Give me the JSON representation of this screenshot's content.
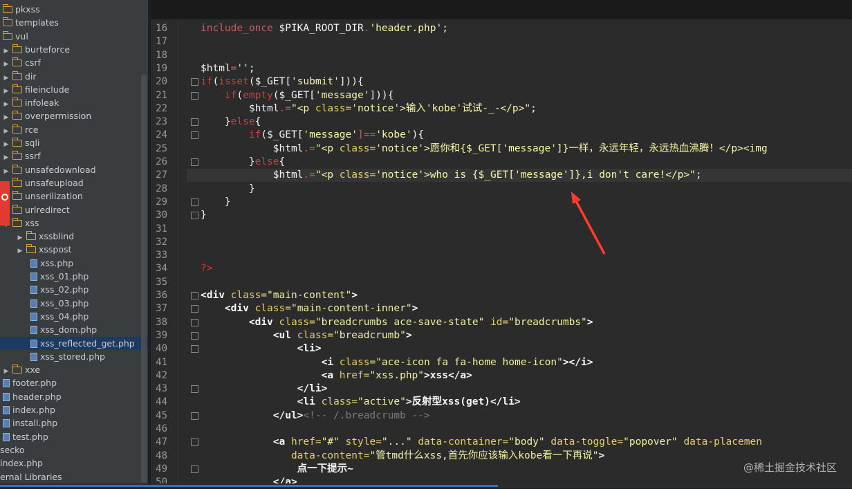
{
  "sidebar": {
    "items": [
      {
        "label": "pkxss",
        "type": "folder",
        "indent": 0,
        "arrow": false
      },
      {
        "label": "templates",
        "type": "folder",
        "indent": 0,
        "arrow": false
      },
      {
        "label": "vul",
        "type": "folder",
        "indent": 0,
        "arrow": false
      },
      {
        "label": "burteforce",
        "type": "folder",
        "indent": 1,
        "arrow": true
      },
      {
        "label": "csrf",
        "type": "folder",
        "indent": 1,
        "arrow": true
      },
      {
        "label": "dir",
        "type": "folder",
        "indent": 1,
        "arrow": true
      },
      {
        "label": "fileinclude",
        "type": "folder",
        "indent": 1,
        "arrow": true
      },
      {
        "label": "infoleak",
        "type": "folder",
        "indent": 1,
        "arrow": true
      },
      {
        "label": "overpermission",
        "type": "folder",
        "indent": 1,
        "arrow": true
      },
      {
        "label": "rce",
        "type": "folder",
        "indent": 1,
        "arrow": true
      },
      {
        "label": "sqli",
        "type": "folder",
        "indent": 1,
        "arrow": true
      },
      {
        "label": "ssrf",
        "type": "folder",
        "indent": 1,
        "arrow": true
      },
      {
        "label": "unsafedownload",
        "type": "folder",
        "indent": 1,
        "arrow": true
      },
      {
        "label": "unsafeupload",
        "type": "folder",
        "indent": 1,
        "arrow": true
      },
      {
        "label": "unserilization",
        "type": "folder",
        "indent": 1,
        "arrow": true
      },
      {
        "label": "urlredirect",
        "type": "folder",
        "indent": 1,
        "arrow": true
      },
      {
        "label": "xss",
        "type": "folder",
        "indent": 1,
        "arrow": false
      },
      {
        "label": "xssblind",
        "type": "folder",
        "indent": 2,
        "arrow": true
      },
      {
        "label": "xsspost",
        "type": "folder",
        "indent": 2,
        "arrow": true
      },
      {
        "label": "xss.php",
        "type": "file",
        "indent": 3,
        "arrow": false
      },
      {
        "label": "xss_01.php",
        "type": "file",
        "indent": 3,
        "arrow": false
      },
      {
        "label": "xss_02.php",
        "type": "file",
        "indent": 3,
        "arrow": false
      },
      {
        "label": "xss_03.php",
        "type": "file",
        "indent": 3,
        "arrow": false
      },
      {
        "label": "xss_04.php",
        "type": "file",
        "indent": 3,
        "arrow": false
      },
      {
        "label": "xss_dom.php",
        "type": "file",
        "indent": 3,
        "arrow": false
      },
      {
        "label": "xss_reflected_get.php",
        "type": "file",
        "indent": 3,
        "arrow": false,
        "selected": true
      },
      {
        "label": "xss_stored.php",
        "type": "file",
        "indent": 3,
        "arrow": false
      },
      {
        "label": "xxe",
        "type": "folder",
        "indent": 1,
        "arrow": true
      },
      {
        "label": "footer.php",
        "type": "file",
        "indent": 0,
        "arrow": false
      },
      {
        "label": "header.php",
        "type": "file",
        "indent": 0,
        "arrow": false
      },
      {
        "label": "index.php",
        "type": "file",
        "indent": 0,
        "arrow": false
      },
      {
        "label": "install.php",
        "type": "file",
        "indent": 0,
        "arrow": false
      },
      {
        "label": "test.php",
        "type": "file",
        "indent": 0,
        "arrow": false
      },
      {
        "label": "secko",
        "type": "plain",
        "indent": 0,
        "arrow": false
      },
      {
        "label": "index.php",
        "type": "plain",
        "indent": 0,
        "arrow": false
      },
      {
        "label": "ernal Libraries",
        "type": "plain",
        "indent": 0,
        "arrow": false
      }
    ]
  },
  "editor": {
    "line_numbers": [
      "16",
      "17",
      "18",
      "19",
      "20",
      "21",
      "22",
      "23",
      "24",
      "25",
      "26",
      "27",
      "28",
      "29",
      "30",
      "31",
      "32",
      "33",
      "34",
      "35",
      "36",
      "37",
      "38",
      "39",
      "40",
      "41",
      "42",
      "43",
      "44",
      "45",
      "46",
      "47",
      "48",
      "49",
      "50"
    ],
    "lines": [
      [
        {
          "t": "include_once",
          "c": "dim"
        },
        {
          "t": " $PIKA_ROOT_DIR",
          "c": "v"
        },
        {
          "t": ".",
          "c": "dim"
        },
        {
          "t": "'header.php'",
          "c": "str"
        },
        {
          "t": ";",
          "c": "v"
        }
      ],
      [],
      [],
      [
        {
          "t": "$html",
          "c": "v"
        },
        {
          "t": "=",
          "c": "dim"
        },
        {
          "t": "''",
          "c": "str"
        },
        {
          "t": ";",
          "c": "v"
        }
      ],
      [
        {
          "t": "if",
          "c": "k"
        },
        {
          "t": "(",
          "c": "v"
        },
        {
          "t": "isset",
          "c": "k"
        },
        {
          "t": "($_GET[",
          "c": "v"
        },
        {
          "t": "'submit'",
          "c": "str"
        },
        {
          "t": "])){",
          "c": "v"
        }
      ],
      [
        {
          "t": "    if",
          "c": "k"
        },
        {
          "t": "(",
          "c": "v"
        },
        {
          "t": "empty",
          "c": "k"
        },
        {
          "t": "($_GET[",
          "c": "v"
        },
        {
          "t": "'message'",
          "c": "str"
        },
        {
          "t": "])){",
          "c": "v"
        }
      ],
      [
        {
          "t": "        $html",
          "c": "v"
        },
        {
          "t": ".=",
          "c": "dim"
        },
        {
          "t": "\"<p ",
          "c": "str"
        },
        {
          "t": "class=",
          "c": "a"
        },
        {
          "t": "'notice'",
          "c": "str"
        },
        {
          "t": ">输入'kobe'试试-_-</p>\"",
          "c": "str"
        },
        {
          "t": ";",
          "c": "v"
        }
      ],
      [
        {
          "t": "    }",
          "c": "v"
        },
        {
          "t": "else",
          "c": "k"
        },
        {
          "t": "{",
          "c": "v"
        }
      ],
      [
        {
          "t": "        if",
          "c": "k"
        },
        {
          "t": "($_GET[",
          "c": "v"
        },
        {
          "t": "'message'",
          "c": "str"
        },
        {
          "t": "]==",
          "c": "dim"
        },
        {
          "t": "'kobe'",
          "c": "str"
        },
        {
          "t": "){",
          "c": "v"
        }
      ],
      [
        {
          "t": "            $html",
          "c": "v"
        },
        {
          "t": ".=",
          "c": "dim"
        },
        {
          "t": "\"<p ",
          "c": "str"
        },
        {
          "t": "class=",
          "c": "a"
        },
        {
          "t": "'notice'",
          "c": "str"
        },
        {
          "t": ">愿你和{$_GET['message']}一样，永远年轻，永远热血沸腾！</p><img",
          "c": "str"
        }
      ],
      [
        {
          "t": "        }",
          "c": "v"
        },
        {
          "t": "else",
          "c": "k"
        },
        {
          "t": "{",
          "c": "v"
        }
      ],
      [
        {
          "t": "            $html",
          "c": "v"
        },
        {
          "t": ".=",
          "c": "dim"
        },
        {
          "t": "\"<p ",
          "c": "str"
        },
        {
          "t": "class=",
          "c": "a"
        },
        {
          "t": "'notice'",
          "c": "str"
        },
        {
          "t": ">who is {$_GET['message']},i don't care!</p>\"",
          "c": "str"
        },
        {
          "t": ";",
          "c": "v"
        }
      ],
      [
        {
          "t": "        }",
          "c": "v"
        }
      ],
      [
        {
          "t": "    }",
          "c": "v"
        }
      ],
      [
        {
          "t": "}",
          "c": "v"
        }
      ],
      [],
      [],
      [],
      [
        {
          "t": "?>",
          "c": "k"
        }
      ],
      [],
      [
        {
          "t": "<div ",
          "c": "tag"
        },
        {
          "t": "class=",
          "c": "a"
        },
        {
          "t": "\"main-content\"",
          "c": "av"
        },
        {
          "t": ">",
          "c": "tag"
        }
      ],
      [
        {
          "t": "    <div ",
          "c": "tag"
        },
        {
          "t": "class=",
          "c": "a"
        },
        {
          "t": "\"main-content-inner\"",
          "c": "av"
        },
        {
          "t": ">",
          "c": "tag"
        }
      ],
      [
        {
          "t": "        <div ",
          "c": "tag"
        },
        {
          "t": "class=",
          "c": "a"
        },
        {
          "t": "\"breadcrumbs ace-save-state\" ",
          "c": "av"
        },
        {
          "t": "id=",
          "c": "a"
        },
        {
          "t": "\"breadcrumbs\"",
          "c": "av"
        },
        {
          "t": ">",
          "c": "tag"
        }
      ],
      [
        {
          "t": "            <ul ",
          "c": "tag"
        },
        {
          "t": "class=",
          "c": "a"
        },
        {
          "t": "\"breadcrumb\"",
          "c": "av"
        },
        {
          "t": ">",
          "c": "tag"
        }
      ],
      [
        {
          "t": "                <li>",
          "c": "tag"
        }
      ],
      [
        {
          "t": "                    <i ",
          "c": "tag"
        },
        {
          "t": "class=",
          "c": "a"
        },
        {
          "t": "\"ace-icon fa fa-home home-icon\"",
          "c": "av"
        },
        {
          "t": "></i>",
          "c": "tag"
        }
      ],
      [
        {
          "t": "                    <a ",
          "c": "tag"
        },
        {
          "t": "href=",
          "c": "a"
        },
        {
          "t": "\"xss.php\"",
          "c": "av"
        },
        {
          "t": ">xss</a>",
          "c": "tag"
        }
      ],
      [
        {
          "t": "                </li>",
          "c": "tag"
        }
      ],
      [
        {
          "t": "                <li ",
          "c": "tag"
        },
        {
          "t": "class=",
          "c": "a"
        },
        {
          "t": "\"active\"",
          "c": "av"
        },
        {
          "t": ">反射型xss(get)</li>",
          "c": "tag"
        }
      ],
      [
        {
          "t": "            </ul>",
          "c": "tag"
        },
        {
          "t": "<!-- /.breadcrumb -->",
          "c": "cm"
        }
      ],
      [],
      [
        {
          "t": "            <a ",
          "c": "tag"
        },
        {
          "t": "href=",
          "c": "a"
        },
        {
          "t": "\"#\" ",
          "c": "av"
        },
        {
          "t": "style=",
          "c": "a"
        },
        {
          "t": "\"...\" ",
          "c": "av"
        },
        {
          "t": "data-container=",
          "c": "a"
        },
        {
          "t": "\"body\" ",
          "c": "av"
        },
        {
          "t": "data-toggle=",
          "c": "a"
        },
        {
          "t": "\"popover\" ",
          "c": "av"
        },
        {
          "t": "data-placemen",
          "c": "a"
        }
      ],
      [
        {
          "t": "               data-content=",
          "c": "a"
        },
        {
          "t": "\"管tmd什么xss,首先你应该输入kobe看一下再说\"",
          "c": "av"
        },
        {
          "t": ">",
          "c": "tag"
        }
      ],
      [
        {
          "t": "                点一下提示~",
          "c": "tag"
        }
      ],
      [
        {
          "t": "            </a>",
          "c": "tag"
        }
      ]
    ]
  },
  "watermark": "@稀土掘金技术社区"
}
